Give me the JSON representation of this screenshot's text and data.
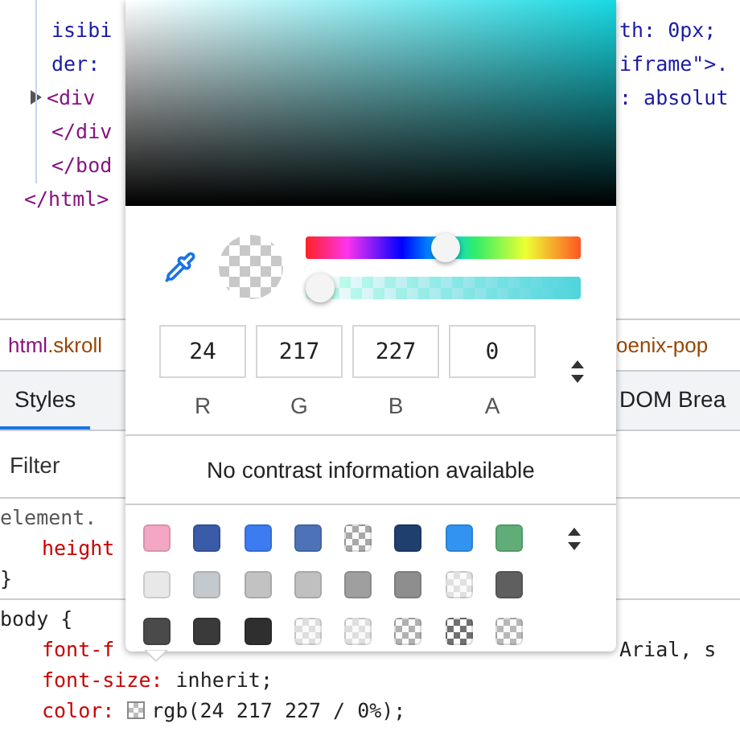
{
  "dom_tree": {
    "closing": "</html>",
    "children": [
      {
        "text": "isibi",
        "kind": "attr",
        "right": "th: 0px;"
      },
      {
        "text": "der:",
        "kind": "attr",
        "right": "iframe\">."
      },
      {
        "text": "<div",
        "kind": "tag",
        "expanded": false,
        "right": ": absolut"
      },
      {
        "text": "</div",
        "kind": "tag"
      },
      {
        "text": "</bod",
        "kind": "tag"
      }
    ]
  },
  "breadcrumb": {
    "tag": "html",
    "classes": ".skroll",
    "right": "oenix-pop"
  },
  "tabs": [
    {
      "label": "Styles",
      "selected": true
    },
    {
      "label": "DOM Brea",
      "selected": false
    }
  ],
  "filter": {
    "placeholder": "Filter"
  },
  "rules": [
    {
      "selector": "element.",
      "kind": "inline",
      "declarations": [
        {
          "property": "height"
        }
      ],
      "closing": "}"
    },
    {
      "selector": "body {",
      "kind": "normal",
      "declarations": [
        {
          "property": "font-f",
          "right": "Arial, s"
        },
        {
          "property": "font-size:",
          "value": "inherit;"
        },
        {
          "property": "color:",
          "value": "rgb(24 217 227 / 0%);",
          "swatch": true
        }
      ]
    }
  ],
  "picker": {
    "hue": {
      "level": 0.51
    },
    "alpha": {
      "level": 0
    },
    "channels": [
      {
        "value": "24",
        "label": "R"
      },
      {
        "value": "217",
        "label": "G"
      },
      {
        "value": "227",
        "label": "B"
      },
      {
        "value": "0",
        "label": "A"
      }
    ],
    "contrast": "No contrast information available",
    "swatches": [
      {
        "color": "#f4a7c4",
        "kind": "solid"
      },
      {
        "color": "#3a5ca8",
        "kind": "solid"
      },
      {
        "color": "#3c7cf0",
        "kind": "solid"
      },
      {
        "color": "#4d72b8",
        "kind": "solid"
      },
      {
        "color": "#a8a8a8",
        "kind": "checker"
      },
      {
        "color": "#1f3f6e",
        "kind": "solid"
      },
      {
        "color": "#3294f0",
        "kind": "solid"
      },
      {
        "color": "#60ad78",
        "kind": "solid"
      },
      {
        "color": "#e8e8e8",
        "kind": "solid"
      },
      {
        "color": "#c4c9ce",
        "kind": "solid"
      },
      {
        "color": "#c2c2c2",
        "kind": "solid"
      },
      {
        "color": "#c0c0c0",
        "kind": "solid"
      },
      {
        "color": "#9f9f9f",
        "kind": "solid"
      },
      {
        "color": "#8e8e8e",
        "kind": "solid"
      },
      {
        "color": "#e0e0e0",
        "kind": "checker"
      },
      {
        "color": "#5f5f5f",
        "kind": "solid"
      },
      {
        "color": "#4a4a4a",
        "kind": "solid"
      },
      {
        "color": "#3a3a3a",
        "kind": "solid"
      },
      {
        "color": "#2f2f2f",
        "kind": "solid"
      },
      {
        "color": "#dedede",
        "kind": "checker"
      },
      {
        "color": "#dedede",
        "kind": "checker"
      },
      {
        "color": "#b0b0b0",
        "kind": "checker"
      },
      {
        "color": "#707070",
        "kind": "checker"
      },
      {
        "color": "#b8b8b8",
        "kind": "checker"
      }
    ]
  }
}
